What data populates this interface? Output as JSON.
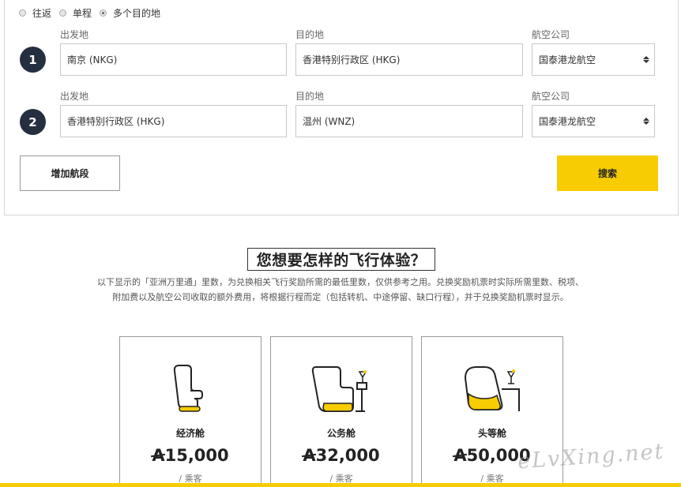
{
  "trip_types": [
    {
      "label": "往返",
      "selected": false
    },
    {
      "label": "单程",
      "selected": false
    },
    {
      "label": "多个目的地",
      "selected": true
    }
  ],
  "segments": [
    {
      "number": "1",
      "origin_label": "出发地",
      "origin": "南京 (NKG)",
      "destination_label": "目的地",
      "destination": "香港特别行政区 (HKG)",
      "airline_label": "航空公司",
      "airline": "国泰港龙航空"
    },
    {
      "number": "2",
      "origin_label": "出发地",
      "origin": "香港特别行政区 (HKG)",
      "destination_label": "目的地",
      "destination": "温州 (WNZ)",
      "airline_label": "航空公司",
      "airline": "国泰港龙航空"
    }
  ],
  "add_segment_label": "增加航段",
  "search_label": "搜索",
  "experience": {
    "heading": "您想要怎样的飞行体验？",
    "desc_line1": "以下显示的「亚洲万里通」里数，为兑换相关飞行奖励所需的最低里数，仅供参考之用。兑换奖励机票时实际所需里数、税项、",
    "desc_line2": "附加费以及航空公司收取的额外费用，将根据行程而定（包括转机、中途停留、缺口行程），并于兑换奖励机票时显示。"
  },
  "cabins": [
    {
      "name": "经济舱",
      "currency_symbol": "A",
      "miles": "15,000",
      "per": "/ 乘客",
      "icon": "economy-seat-icon"
    },
    {
      "name": "公务舱",
      "currency_symbol": "A",
      "miles": "32,000",
      "per": "/ 乘客",
      "icon": "business-seat-icon"
    },
    {
      "name": "头等舱",
      "currency_symbol": "A",
      "miles": "50,000",
      "per": "/ 乘客",
      "icon": "first-class-seat-icon"
    }
  ],
  "colors": {
    "accent": "#f7cc02",
    "badge": "#243040"
  },
  "watermark": "eLvXing.net"
}
